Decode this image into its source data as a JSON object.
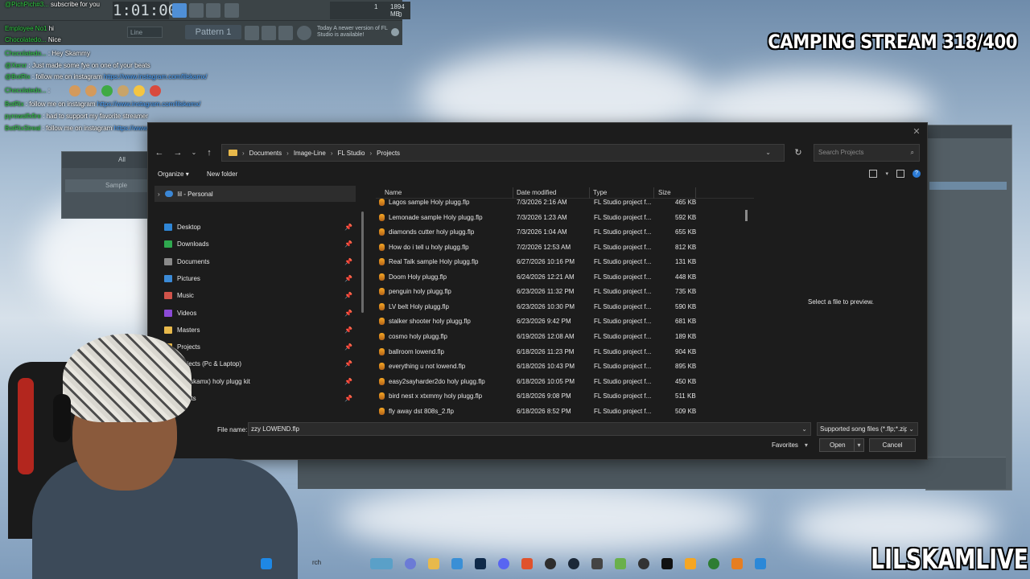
{
  "stream": {
    "title": "CAMPING STREAM 318/400",
    "watermark": "LILSKAMLIVE"
  },
  "fl_studio": {
    "time": "1:01:00",
    "stats_top": "1",
    "stats_mb": "1894 MB",
    "stats_bottom": "0",
    "mode": "Line",
    "pattern": "Pattern 1",
    "notify_day": "Today",
    "notify_text": "A newer version of FL Studio is available!",
    "bg_window_tab": "All",
    "bg_window_row": "Sample",
    "bg_window_num": "1"
  },
  "chat": [
    {
      "user": "@PichPich#3...",
      "msg": "subscribe for you"
    },
    {
      "user": "Employee No1",
      "msg": "hi"
    },
    {
      "user": "Chocolatedo...",
      "msg": "Nice"
    },
    {
      "user": "Chocolatedo...",
      "msg": "Hey Skammy"
    },
    {
      "user": "@Xerxr",
      "msg": "Just made some fye on one of your beats"
    },
    {
      "user": "@BotRix",
      "msg": "follow me on instagram",
      "link": "https://www.instagram.com/lilskamx/"
    },
    {
      "user": "Chocolatedo...",
      "msg": ""
    },
    {
      "user": "BotRix",
      "msg": "follow me on instagram",
      "link": "https://www.instagram.com/lilskamx/"
    },
    {
      "user": "pyrowolfxfire",
      "msg": "had to support my favorite streamer"
    },
    {
      "user": "BotRixStreal",
      "msg": "follow me on instagram",
      "link": "https://www.instagram.com/lilskamx/"
    }
  ],
  "dialog": {
    "breadcrumbs": [
      "Documents",
      "Image-Line",
      "FL Studio",
      "Projects"
    ],
    "search_placeholder": "Search Projects",
    "organize": "Organize",
    "new_folder": "New folder",
    "onedrive": "lil - Personal",
    "nav_items": [
      {
        "label": "Desktop",
        "color": "#2f86d6"
      },
      {
        "label": "Downloads",
        "color": "#2fa84f"
      },
      {
        "label": "Documents",
        "color": "#8a8a8a"
      },
      {
        "label": "Pictures",
        "color": "#3b8ad6"
      },
      {
        "label": "Music",
        "color": "#d0534a"
      },
      {
        "label": "Videos",
        "color": "#8b4ad6"
      },
      {
        "label": "Masters",
        "color": "#e8b94b"
      },
      {
        "label": "Projects",
        "color": "#e8b94b"
      },
      {
        "label": "Projects (Pc & Laptop)",
        "color": "#e8b94b"
      },
      {
        "label": "(@lilskamx) holy plugg kit",
        "color": "#e8b94b"
      },
      {
        "label": "nshots",
        "color": "#e8b94b"
      }
    ],
    "columns": {
      "name": "Name",
      "date": "Date modified",
      "type": "Type",
      "size": "Size"
    },
    "files": [
      {
        "name": "Lagos sample Holy plugg.flp",
        "date": "7/3/2026 2:16 AM",
        "type": "FL Studio project f...",
        "size": "465 KB"
      },
      {
        "name": "Lemonade sample Holy plugg.flp",
        "date": "7/3/2026 1:23 AM",
        "type": "FL Studio project f...",
        "size": "592 KB"
      },
      {
        "name": "diamonds cutter holy plugg.flp",
        "date": "7/3/2026 1:04 AM",
        "type": "FL Studio project f...",
        "size": "655 KB"
      },
      {
        "name": "How do i tell u holy plugg.flp",
        "date": "7/2/2026 12:53 AM",
        "type": "FL Studio project f...",
        "size": "812 KB"
      },
      {
        "name": "Real Talk sample Holy plugg.flp",
        "date": "6/27/2026 10:16 PM",
        "type": "FL Studio project f...",
        "size": "131 KB"
      },
      {
        "name": "Doom Holy plugg.flp",
        "date": "6/24/2026 12:21 AM",
        "type": "FL Studio project f...",
        "size": "448 KB"
      },
      {
        "name": "penguin holy plugg.flp",
        "date": "6/23/2026 11:32 PM",
        "type": "FL Studio project f...",
        "size": "735 KB"
      },
      {
        "name": "LV belt Holy plugg.flp",
        "date": "6/23/2026 10:30 PM",
        "type": "FL Studio project f...",
        "size": "590 KB"
      },
      {
        "name": "stalker shooter holy plugg.flp",
        "date": "6/23/2026 9:42 PM",
        "type": "FL Studio project f...",
        "size": "681 KB"
      },
      {
        "name": "cosmo holy plugg.flp",
        "date": "6/19/2026 12:08 AM",
        "type": "FL Studio project f...",
        "size": "189 KB"
      },
      {
        "name": "ballroom lowend.flp",
        "date": "6/18/2026 11:23 PM",
        "type": "FL Studio project f...",
        "size": "904 KB"
      },
      {
        "name": "everything u not lowend.flp",
        "date": "6/18/2026 10:43 PM",
        "type": "FL Studio project f...",
        "size": "895 KB"
      },
      {
        "name": "easy2sayharder2do holy plugg.flp",
        "date": "6/18/2026 10:05 PM",
        "type": "FL Studio project f...",
        "size": "450 KB"
      },
      {
        "name": "bird nest x xtxmmy holy plugg.flp",
        "date": "6/18/2026 9:08 PM",
        "type": "FL Studio project f...",
        "size": "511 KB"
      },
      {
        "name": "fly away dst 808s_2.flp",
        "date": "6/18/2026 8:52 PM",
        "type": "FL Studio project f...",
        "size": "509 KB"
      }
    ],
    "preview_text": "Select a file to preview.",
    "file_name_label": "File name:",
    "file_name_value": "zzy LOWEND.flp",
    "file_type": "Supported song files (*.flp;*.zip;",
    "favorites": "Favorites",
    "open": "Open",
    "cancel": "Cancel"
  },
  "taskbar": {
    "search_label": "rch"
  }
}
